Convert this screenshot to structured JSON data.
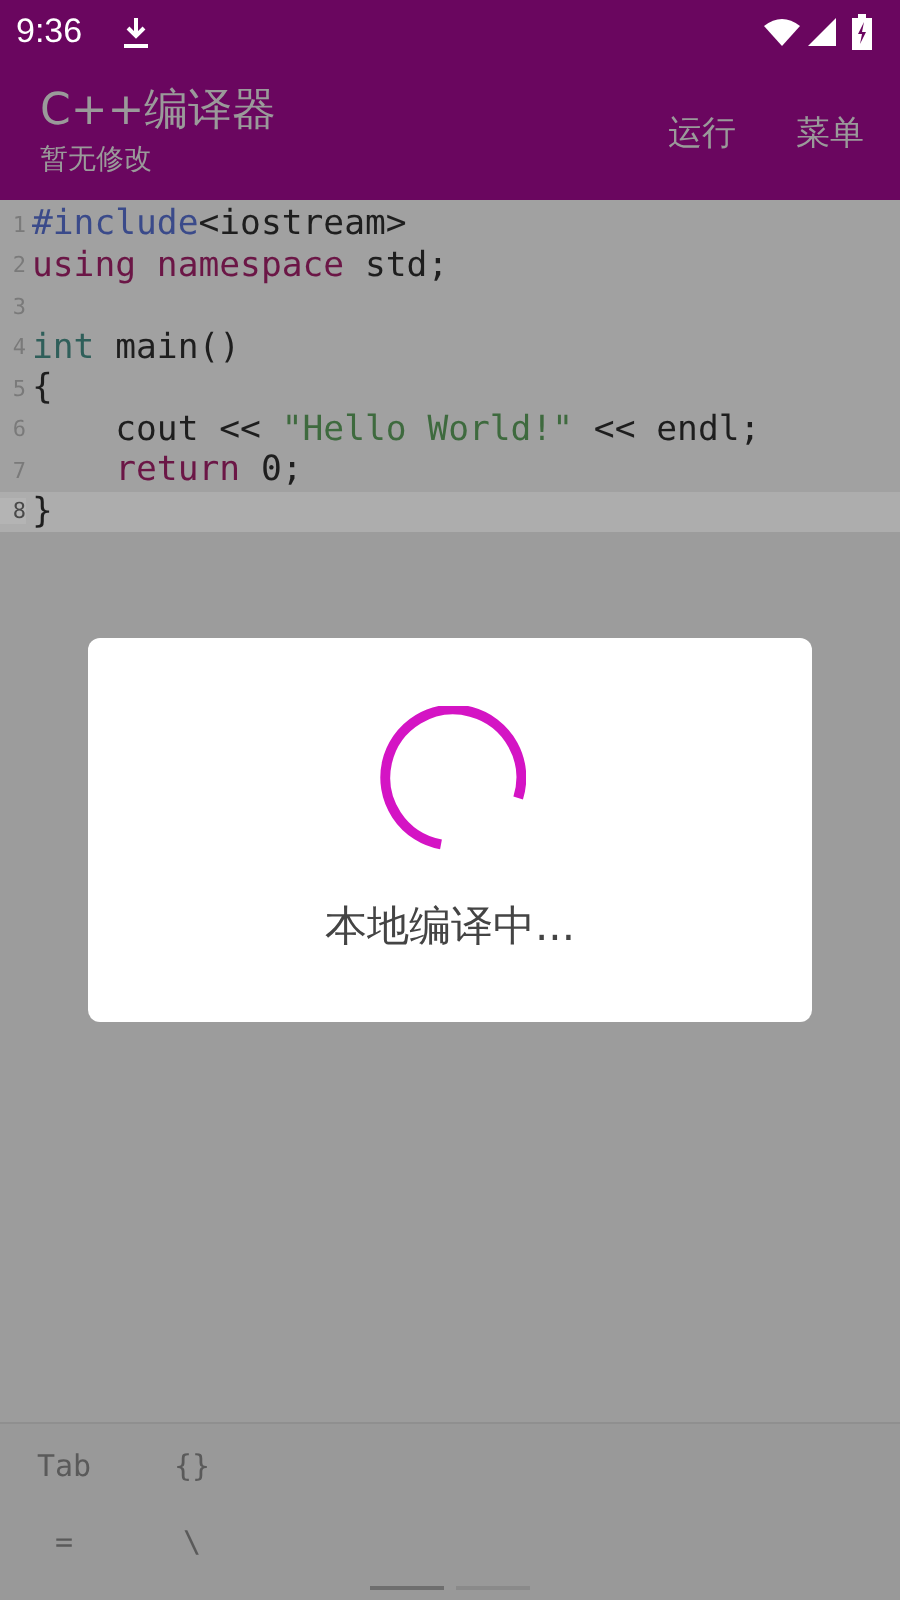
{
  "status_bar": {
    "time": "9:36"
  },
  "app_bar": {
    "title": "C++编译器",
    "subtitle": "暂无修改",
    "actions": [
      "运行",
      "菜单"
    ]
  },
  "editor": {
    "lines": [
      {
        "number": "1",
        "current": false,
        "tokens": [
          {
            "text": "#include",
            "kind": "preprocessor"
          },
          {
            "text": "<iostream>",
            "kind": "plain"
          }
        ]
      },
      {
        "number": "2",
        "current": false,
        "tokens": [
          {
            "text": "using",
            "kind": "keyword"
          },
          {
            "text": " namespace",
            "kind": "keyword"
          },
          {
            "text": " std;",
            "kind": "plain"
          }
        ]
      },
      {
        "number": "3",
        "current": false
      },
      {
        "number": "4",
        "current": false,
        "tokens": [
          {
            "text": "int",
            "kind": "type"
          },
          {
            "text": " main()",
            "kind": "plain"
          }
        ]
      },
      {
        "number": "5",
        "current": false,
        "tokens": [
          {
            "text": "{",
            "kind": "plain"
          }
        ]
      },
      {
        "number": "6",
        "current": false,
        "tokens": [
          {
            "text": "    cout << ",
            "kind": "plain"
          },
          {
            "text": "\"Hello World!\"",
            "kind": "string"
          },
          {
            "text": " << endl;",
            "kind": "plain"
          }
        ]
      },
      {
        "number": "7",
        "current": false,
        "tokens": [
          {
            "text": "    return",
            "kind": "keyword"
          },
          {
            "text": " 0;",
            "kind": "plain"
          }
        ]
      },
      {
        "number": "8",
        "current": true,
        "tokens": [
          {
            "text": "}",
            "kind": "plain"
          }
        ]
      }
    ]
  },
  "dialog": {
    "message": "本地编译中..."
  },
  "symbol_bar": {
    "rows": [
      [
        "Tab",
        "{}"
      ],
      [
        "=",
        "\\"
      ]
    ]
  }
}
